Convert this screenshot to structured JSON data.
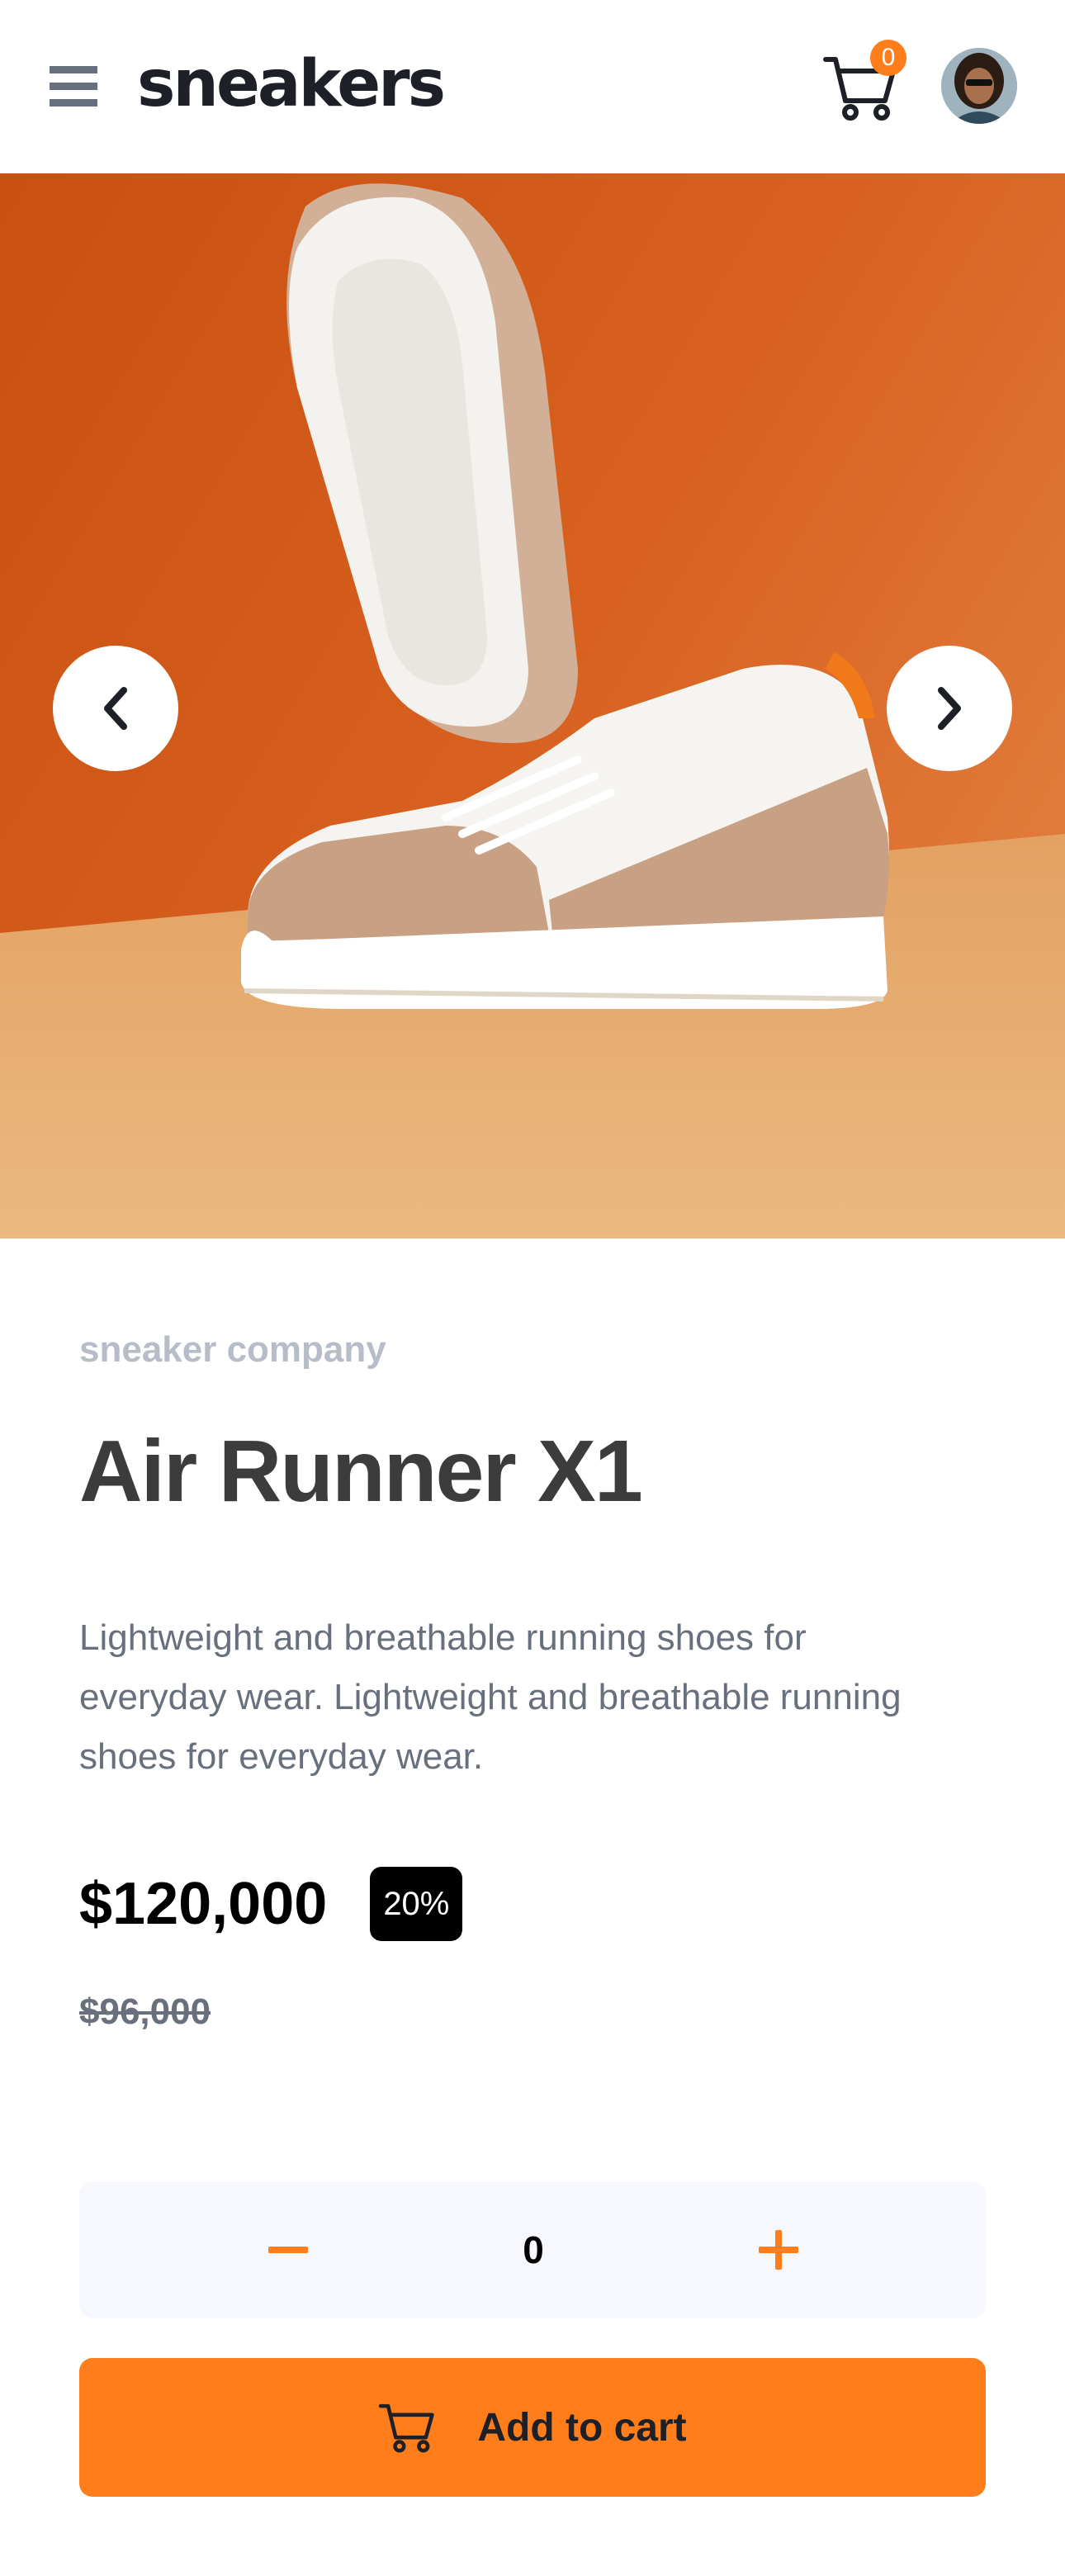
{
  "header": {
    "logo": "sneakers",
    "cart_count": "0"
  },
  "product": {
    "company": "sneaker company",
    "title": "Air Runner X1",
    "description": "Lightweight and breathable running shoes for everyday wear. Lightweight and breathable running shoes for everyday wear.",
    "price": "$120,000",
    "discount": "20%",
    "old_price": "$96,000"
  },
  "quantity": {
    "value": "0"
  },
  "actions": {
    "add_to_cart_label": "Add to cart"
  },
  "icons": {
    "menu": "menu-icon",
    "cart": "cart-icon",
    "prev": "chevron-left-icon",
    "next": "chevron-right-icon",
    "minus": "minus-icon",
    "plus": "plus-icon"
  },
  "colors": {
    "accent": "#ff7e1b",
    "text_dark": "#1d2026",
    "text_muted": "#69707d",
    "qty_bg": "#f6f8fd"
  }
}
